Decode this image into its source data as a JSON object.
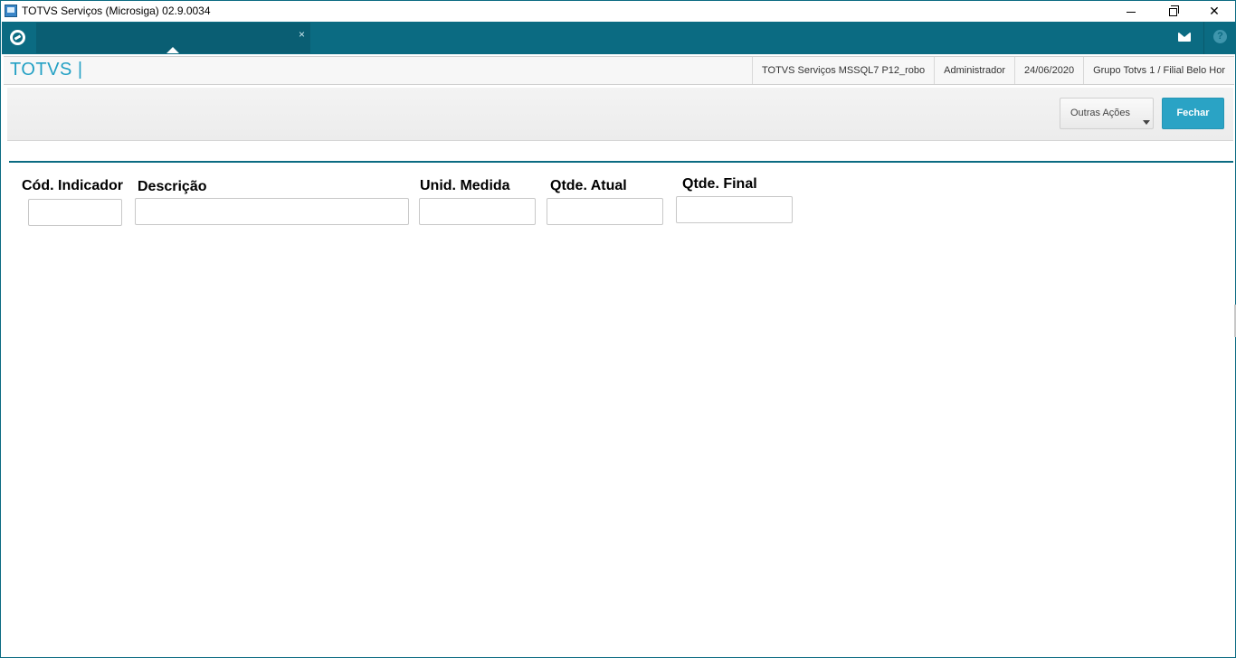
{
  "window": {
    "title": "TOTVS Serviços (Microsiga) 02.9.0034"
  },
  "topbar": {
    "tab_close": "×",
    "help": "?"
  },
  "header": {
    "brand": "TOTVS |",
    "info": [
      "TOTVS Serviços MSSQL7 P12_robo",
      "Administrador",
      "24/06/2020",
      "Grupo Totvs 1 / Filial Belo Hor"
    ]
  },
  "toolbar": {
    "outras_acoes_label": "Outras Ações",
    "fechar_label": "Fechar"
  },
  "form": {
    "fields": [
      {
        "label": "Cód. Indicador",
        "value": ""
      },
      {
        "label": "Descrição",
        "value": ""
      },
      {
        "label": "Unid. Medida",
        "value": ""
      },
      {
        "label": "Qtde. Atual",
        "value": ""
      },
      {
        "label": "Qtde. Final",
        "value": ""
      }
    ]
  },
  "colors": {
    "primary": "#0b6b82",
    "accent": "#2aa3c5",
    "brand": "#23a0c4"
  }
}
